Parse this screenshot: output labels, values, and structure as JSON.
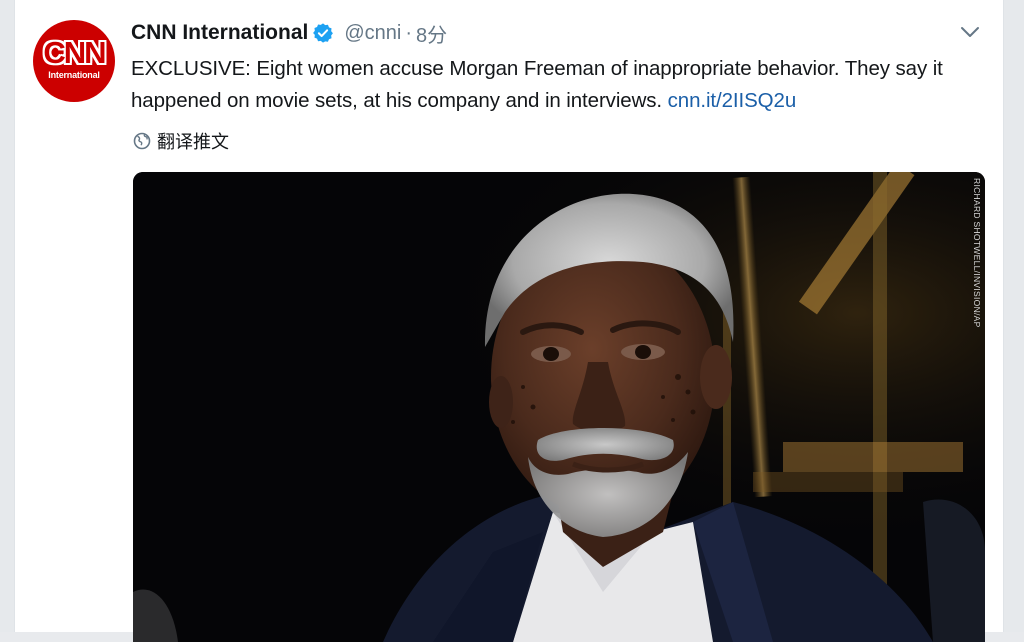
{
  "tweet": {
    "author": {
      "display_name": "CNN International",
      "handle": "@cnni",
      "verified": true,
      "avatar_logo": "CNN",
      "avatar_sub": "International"
    },
    "separator": "·",
    "time": "8分",
    "text_main": "EXCLUSIVE: Eight women accuse Morgan Freeman of inappropriate behavior. They say it happened on movie sets, at his company and in interviews. ",
    "link_text": "cnn.it/2IISQ2u",
    "translate_label": "翻译推文",
    "media": {
      "photo_credit": "RICHARD SHOTWELL/INVISION/AP"
    }
  },
  "colors": {
    "brand_red": "#cc0000",
    "verified_blue": "#1da1f2",
    "link_blue": "#1b5fa8",
    "secondary_text": "#657786"
  },
  "icons": [
    "verified-badge-icon",
    "chevron-down-icon",
    "globe-icon"
  ]
}
